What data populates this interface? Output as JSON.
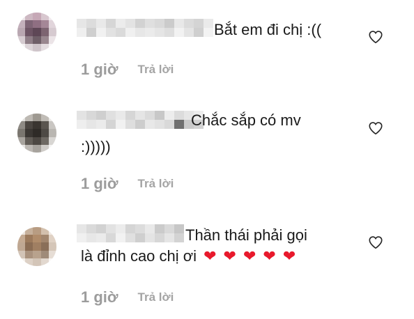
{
  "comments": [
    {
      "text_line1": "Bắt em đi chị :((",
      "text_line2": "",
      "hearts": [],
      "time": "1 giờ",
      "reply_label": "Trả lời",
      "like_icon": "heart-outline-icon"
    },
    {
      "text_line1": "Chắc sắp có mv",
      "text_line2": ":)))))",
      "hearts": [],
      "time": "1 giờ",
      "reply_label": "Trả lời",
      "like_icon": "heart-outline-icon"
    },
    {
      "text_line1": "Thần thái phải gọi",
      "text_line2": "là đỉnh cao chị ơi",
      "hearts": [
        "❤",
        "❤",
        "❤",
        "❤",
        "❤"
      ],
      "time": "1 giờ",
      "reply_label": "Trả lời",
      "like_icon": "heart-outline-icon"
    }
  ],
  "colors": {
    "heart_emoji": "#e8192c",
    "meta_text": "#9c9c9c"
  }
}
